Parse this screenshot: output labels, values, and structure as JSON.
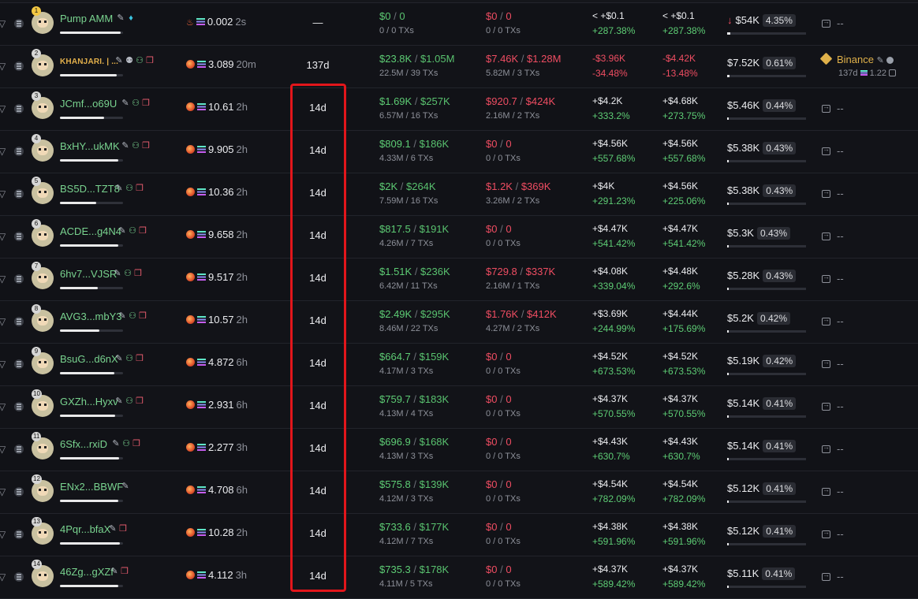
{
  "rows": [
    {
      "rank": "1",
      "name": "Pump AMM",
      "token_icon": "fire",
      "token": "0.002",
      "age": "2s",
      "held": "—",
      "bought": "$0",
      "bought_total": "0",
      "bought_sub": "0 / 0 TXs",
      "sold": "$0",
      "sold_total": "0",
      "sold_sub": "0 / 0 TXs",
      "pnl": "< +$0.1",
      "pnl_pct": "+287.38%",
      "upnl": "< +$0.1",
      "upnl_pct": "+287.38%",
      "remaining": "$54K",
      "remaining_pct": "4.35%",
      "funding": "--"
    },
    {
      "rank": "2",
      "name": "KHANJARI. | ...",
      "token_icon": "flame",
      "token": "3.089",
      "age": "20m",
      "held": "137d",
      "bought": "$23.8K",
      "bought_total": "$1.05M",
      "bought_sub": "22.5M / 39 TXs",
      "sold": "$7.46K",
      "sold_total": "$1.28M",
      "sold_sub": "5.82M / 3 TXs",
      "pnl": "-$3.96K",
      "pnl_pct": "-34.48%",
      "upnl": "-$4.42K",
      "upnl_pct": "-13.48%",
      "remaining": "$7.52K",
      "remaining_pct": "0.61%",
      "funding_name": "Binance",
      "funding_sub": "137d",
      "funding_sol": "1.22"
    },
    {
      "rank": "3",
      "name": "JCmf...o69U",
      "token_icon": "flame",
      "token": "10.61",
      "age": "2h",
      "held": "14d",
      "bought": "$1.69K",
      "bought_total": "$257K",
      "bought_sub": "6.57M / 16 TXs",
      "sold": "$920.7",
      "sold_total": "$424K",
      "sold_sub": "2.16M / 2 TXs",
      "pnl": "+$4.2K",
      "pnl_pct": "+333.2%",
      "upnl": "+$4.68K",
      "upnl_pct": "+273.75%",
      "remaining": "$5.46K",
      "remaining_pct": "0.44%",
      "funding": "--"
    },
    {
      "rank": "4",
      "name": "BxHY...ukMK",
      "token_icon": "flame",
      "token": "9.905",
      "age": "2h",
      "held": "14d",
      "bought": "$809.1",
      "bought_total": "$186K",
      "bought_sub": "4.33M / 6 TXs",
      "sold": "$0",
      "sold_total": "0",
      "sold_sub": "0 / 0 TXs",
      "pnl": "+$4.56K",
      "pnl_pct": "+557.68%",
      "upnl": "+$4.56K",
      "upnl_pct": "+557.68%",
      "remaining": "$5.38K",
      "remaining_pct": "0.43%",
      "funding": "--"
    },
    {
      "rank": "5",
      "name": "BS5D...TZT8",
      "token_icon": "flame",
      "token": "10.36",
      "age": "2h",
      "held": "14d",
      "bought": "$2K",
      "bought_total": "$264K",
      "bought_sub": "7.59M / 16 TXs",
      "sold": "$1.2K",
      "sold_total": "$369K",
      "sold_sub": "3.26M / 2 TXs",
      "pnl": "+$4K",
      "pnl_pct": "+291.23%",
      "upnl": "+$4.56K",
      "upnl_pct": "+225.06%",
      "remaining": "$5.38K",
      "remaining_pct": "0.43%",
      "funding": "--"
    },
    {
      "rank": "6",
      "name": "ACDE...g4N4",
      "token_icon": "flame",
      "token": "9.658",
      "age": "2h",
      "held": "14d",
      "bought": "$817.5",
      "bought_total": "$191K",
      "bought_sub": "4.26M / 7 TXs",
      "sold": "$0",
      "sold_total": "0",
      "sold_sub": "0 / 0 TXs",
      "pnl": "+$4.47K",
      "pnl_pct": "+541.42%",
      "upnl": "+$4.47K",
      "upnl_pct": "+541.42%",
      "remaining": "$5.3K",
      "remaining_pct": "0.43%",
      "funding": "--"
    },
    {
      "rank": "7",
      "name": "6hv7...VJSR",
      "token_icon": "flame",
      "token": "9.517",
      "age": "2h",
      "held": "14d",
      "bought": "$1.51K",
      "bought_total": "$236K",
      "bought_sub": "6.42M / 11 TXs",
      "sold": "$729.8",
      "sold_total": "$337K",
      "sold_sub": "2.16M / 1 TXs",
      "pnl": "+$4.08K",
      "pnl_pct": "+339.04%",
      "upnl": "+$4.48K",
      "upnl_pct": "+292.6%",
      "remaining": "$5.28K",
      "remaining_pct": "0.43%",
      "funding": "--"
    },
    {
      "rank": "8",
      "name": "AVG3...mbY3",
      "token_icon": "flame",
      "token": "10.57",
      "age": "2h",
      "held": "14d",
      "bought": "$2.49K",
      "bought_total": "$295K",
      "bought_sub": "8.46M / 22 TXs",
      "sold": "$1.76K",
      "sold_total": "$412K",
      "sold_sub": "4.27M / 2 TXs",
      "pnl": "+$3.69K",
      "pnl_pct": "+244.99%",
      "upnl": "+$4.44K",
      "upnl_pct": "+175.69%",
      "remaining": "$5.2K",
      "remaining_pct": "0.42%",
      "funding": "--"
    },
    {
      "rank": "9",
      "name": "BsuG...d6nX",
      "token_icon": "flame",
      "token": "4.872",
      "age": "6h",
      "held": "14d",
      "bought": "$664.7",
      "bought_total": "$159K",
      "bought_sub": "4.17M / 3 TXs",
      "sold": "$0",
      "sold_total": "0",
      "sold_sub": "0 / 0 TXs",
      "pnl": "+$4.52K",
      "pnl_pct": "+673.53%",
      "upnl": "+$4.52K",
      "upnl_pct": "+673.53%",
      "remaining": "$5.19K",
      "remaining_pct": "0.42%",
      "funding": "--"
    },
    {
      "rank": "10",
      "name": "GXZh...Hyxv",
      "token_icon": "flame",
      "token": "2.931",
      "age": "6h",
      "held": "14d",
      "bought": "$759.7",
      "bought_total": "$183K",
      "bought_sub": "4.13M / 4 TXs",
      "sold": "$0",
      "sold_total": "0",
      "sold_sub": "0 / 0 TXs",
      "pnl": "+$4.37K",
      "pnl_pct": "+570.55%",
      "upnl": "+$4.37K",
      "upnl_pct": "+570.55%",
      "remaining": "$5.14K",
      "remaining_pct": "0.41%",
      "funding": "--"
    },
    {
      "rank": "11",
      "name": "6Sfx...rxiD",
      "token_icon": "flame",
      "token": "2.277",
      "age": "3h",
      "held": "14d",
      "bought": "$696.9",
      "bought_total": "$168K",
      "bought_sub": "4.13M / 3 TXs",
      "sold": "$0",
      "sold_total": "0",
      "sold_sub": "0 / 0 TXs",
      "pnl": "+$4.43K",
      "pnl_pct": "+630.7%",
      "upnl": "+$4.43K",
      "upnl_pct": "+630.7%",
      "remaining": "$5.14K",
      "remaining_pct": "0.41%",
      "funding": "--"
    },
    {
      "rank": "12",
      "name": "ENx2...BBWF",
      "token_icon": "flame",
      "token": "4.708",
      "age": "6h",
      "held": "14d",
      "bought": "$575.8",
      "bought_total": "$139K",
      "bought_sub": "4.12M / 3 TXs",
      "sold": "$0",
      "sold_total": "0",
      "sold_sub": "0 / 0 TXs",
      "pnl": "+$4.54K",
      "pnl_pct": "+782.09%",
      "upnl": "+$4.54K",
      "upnl_pct": "+782.09%",
      "remaining": "$5.12K",
      "remaining_pct": "0.41%",
      "funding": "--"
    },
    {
      "rank": "13",
      "name": "4Pqr...bfaX",
      "token_icon": "flame",
      "token": "10.28",
      "age": "2h",
      "held": "14d",
      "bought": "$733.6",
      "bought_total": "$177K",
      "bought_sub": "4.12M / 7 TXs",
      "sold": "$0",
      "sold_total": "0",
      "sold_sub": "0 / 0 TXs",
      "pnl": "+$4.38K",
      "pnl_pct": "+591.96%",
      "upnl": "+$4.38K",
      "upnl_pct": "+591.96%",
      "remaining": "$5.12K",
      "remaining_pct": "0.41%",
      "funding": "--"
    },
    {
      "rank": "14",
      "name": "46Zg...gXZf",
      "token_icon": "flame",
      "token": "4.112",
      "age": "3h",
      "held": "14d",
      "bought": "$735.3",
      "bought_total": "$178K",
      "bought_sub": "4.11M / 5 TXs",
      "sold": "$0",
      "sold_total": "0",
      "sold_sub": "0 / 0 TXs",
      "pnl": "+$4.37K",
      "pnl_pct": "+589.42%",
      "upnl": "+$4.37K",
      "upnl_pct": "+589.42%",
      "remaining": "$5.11K",
      "remaining_pct": "0.41%",
      "funding": "--"
    }
  ],
  "colors": {
    "accent_green": "#5dcc74",
    "loss_red": "#ef4d62",
    "highlight": "#e2161b",
    "background": "#0e0f13"
  }
}
